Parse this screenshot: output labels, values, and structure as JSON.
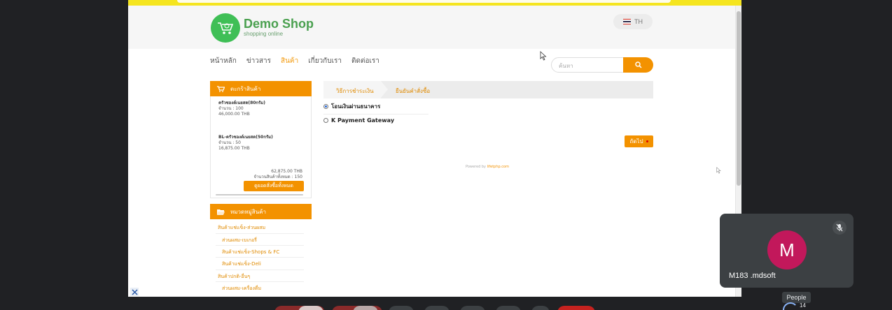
{
  "site": {
    "brand": "Demo Shop",
    "tagline": "shopping online",
    "language": "TH"
  },
  "nav": {
    "items": [
      "หน้าหลัก",
      "ข่าวสาร",
      "สินค้า",
      "เกี่ยวกับเรา",
      "ติดต่อเรา"
    ],
    "active": "สินค้า"
  },
  "search": {
    "placeholder": "ค้นหา"
  },
  "cart": {
    "title": "ตะกร้าสินค้า",
    "items": [
      {
        "name": "ครัวซองต์เนยสด(80กรัม)",
        "qty": "จำนวน : 100",
        "price": "46,000.00 THB"
      },
      {
        "name": "BL-ครัวซองต์เนยสด(50กรัม)",
        "qty": "จำนวน : 50",
        "price": "16,875.00 THB"
      }
    ],
    "total": "62,875.00 THB",
    "total_qty": "จำนวนสินค้าทั้งหมด : 150",
    "view_all": "ดูยอดสั่งซื้อทั้งหมด"
  },
  "categories": {
    "title": "หมวดหมู่สินค้า",
    "items": [
      "สินค้าแช่แข็ง-ส่วนผสม",
      "ส่วนผสม-เบเกอรี่",
      "สินค้าแช่แข็ง-Shops & FC",
      "สินค้าแช่แข็ง-Deli",
      "สินค้าปกติ-อื่นๆ",
      "ส่วนผสม-เครื่องดื่ม"
    ]
  },
  "checkout": {
    "steps": [
      "วิธีการชำระเงิน",
      "ยืนยันคำสั่งซื้อ"
    ],
    "payment_options": [
      "โอนเงินผ่านธนาคาร",
      "K Payment Gateway"
    ],
    "selected_payment": "โอนเงินผ่านธนาคาร",
    "next": "ถัดไป",
    "powered_label": "Powered by",
    "powered_brand": "lifetphp.com"
  },
  "meet": {
    "participant_initial": "M",
    "participant_name": "M183 .mdsoft",
    "people_label": "People",
    "people_count": "14"
  },
  "colors": {
    "accent": "#f39200",
    "brand_green": "#3fbf56",
    "avatar": "#c2185b",
    "meet_bg": "#202124"
  }
}
